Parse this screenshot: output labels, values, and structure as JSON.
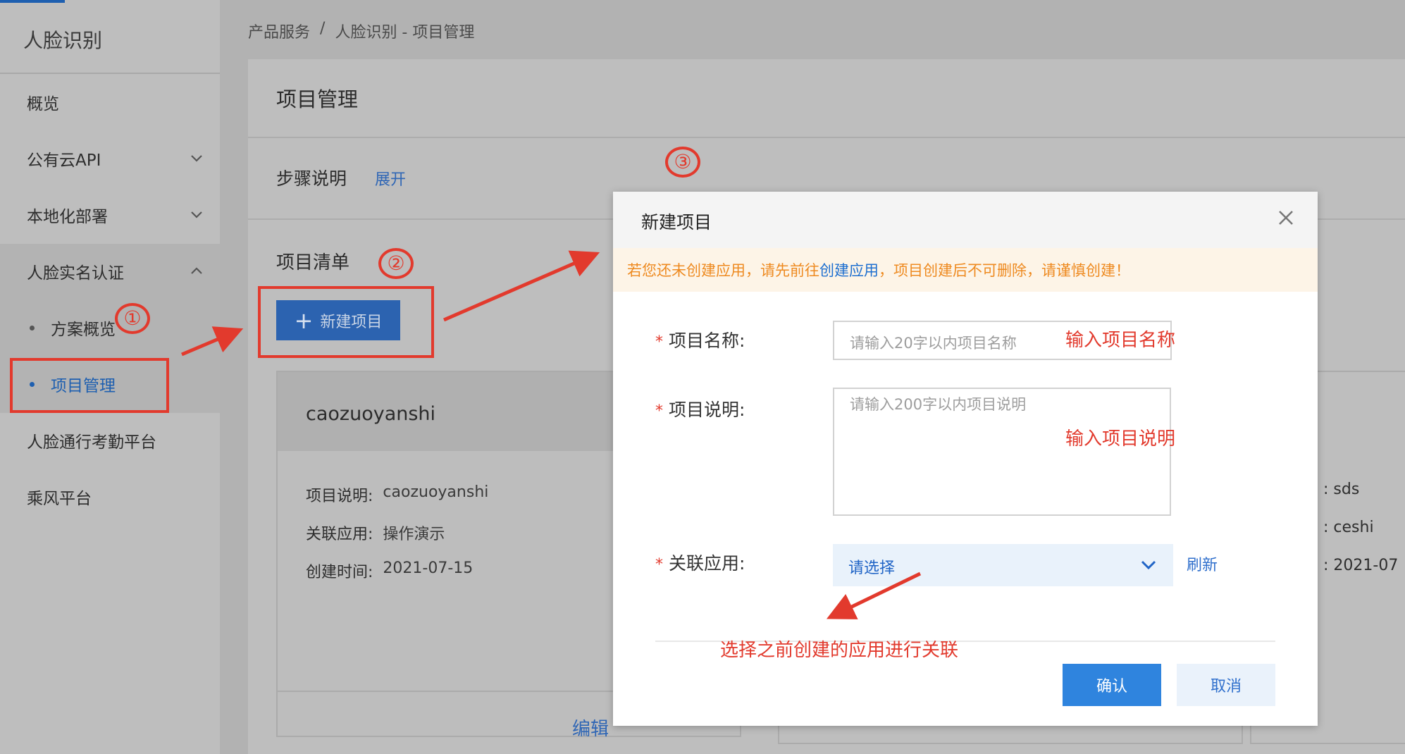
{
  "sidebar": {
    "title": "人脸识别",
    "items": [
      {
        "label": "概览"
      },
      {
        "label": "公有云API"
      },
      {
        "label": "本地化部署"
      },
      {
        "label": "人脸实名认证"
      },
      {
        "label": "方案概览"
      },
      {
        "label": "项目管理"
      },
      {
        "label": "人脸通行考勤平台"
      },
      {
        "label": "乘风平台"
      }
    ]
  },
  "breadcrumb": [
    "产品服务",
    "/",
    "人脸识别 - 项目管理"
  ],
  "page": {
    "title": "项目管理",
    "steps_label": "步骤说明",
    "steps_toggle": "展开",
    "list_label": "项目清单",
    "new_button": "新建项目"
  },
  "card": {
    "name": "caozuoyanshi",
    "rows": [
      {
        "label": "项目说明:",
        "value": "caozuoyanshi"
      },
      {
        "label": "关联应用:",
        "value": "操作演示"
      },
      {
        "label": "创建时间:",
        "value": "2021-07-15"
      }
    ],
    "edit": "编辑"
  },
  "right_card_peek": {
    "row1": ":  sds",
    "row2": ":  ceshi",
    "row3": ":  2021-07"
  },
  "modal": {
    "title": "新建项目",
    "notice_prefix": "若您还未创建应用，请先前往",
    "notice_link": "创建应用",
    "notice_suffix": "，项目创建后不可删除，请谨慎创建！",
    "name_label": "项目名称:",
    "name_placeholder": "请输入20字以内项目名称",
    "desc_label": "项目说明:",
    "desc_placeholder": "请输入200字以内项目说明",
    "app_label": "关联应用:",
    "app_select_value": "请选择",
    "refresh": "刷新",
    "confirm": "确认",
    "cancel": "取消",
    "required_mark": "*"
  },
  "annotations": {
    "step1": "①",
    "step2": "②",
    "step3": "③",
    "hint_name": "输入项目名称",
    "hint_desc": "输入项目说明",
    "hint_app": "选择之前创建的应用进行关联"
  },
  "colors": {
    "primary": "#2f84de",
    "annotation_red": "#e23a2d",
    "notice_orange": "#ee8a20",
    "active_nav": "#1e5fb0"
  }
}
